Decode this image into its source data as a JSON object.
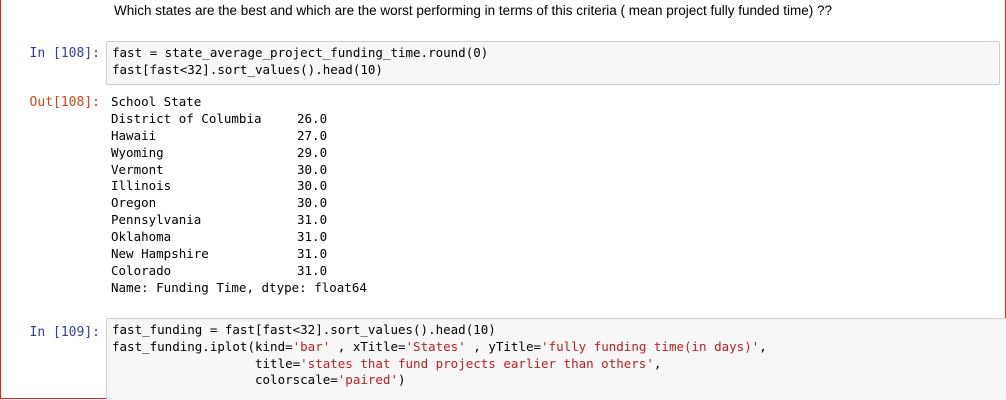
{
  "markdown_text": "Which states are the best and which are the worst performing in terms of this criteria ( mean project fully funded time) ??",
  "cell1": {
    "prompt": "In [108]:",
    "lines": [
      "fast = state_average_project_funding_time.round(0)",
      "fast[fast<32].sort_values().head(10)"
    ]
  },
  "output1": {
    "prompt": "Out[108]:",
    "index_name": "School State",
    "rows": [
      {
        "state": "District of Columbia",
        "value": "26.0"
      },
      {
        "state": "Hawaii",
        "value": "27.0"
      },
      {
        "state": "Wyoming",
        "value": "29.0"
      },
      {
        "state": "Vermont",
        "value": "30.0"
      },
      {
        "state": "Illinois",
        "value": "30.0"
      },
      {
        "state": "Oregon",
        "value": "30.0"
      },
      {
        "state": "Pennsylvania",
        "value": "31.0"
      },
      {
        "state": "Oklahoma",
        "value": "31.0"
      },
      {
        "state": "New Hampshire",
        "value": "31.0"
      },
      {
        "state": "Colorado",
        "value": "31.0"
      }
    ],
    "footer": "Name: Funding Time, dtype: float64"
  },
  "cell2": {
    "prompt": "In [109]:",
    "line1": "fast_funding = fast[fast<32].sort_values().head(10)",
    "line2_pre": "fast_funding.iplot(kind=",
    "line2_s1": "'bar'",
    "line2_mid1": " , xTitle=",
    "line2_s2": "'States'",
    "line2_mid2": " , yTitle=",
    "line2_s3": "'fully funding time(in days)'",
    "line2_post": ",",
    "line3_pre": "                   title=",
    "line3_s": "'states that fund projects earlier than others'",
    "line3_post": ",",
    "line4_pre": "                   colorscale=",
    "line4_s": "'paired'",
    "line4_post": ")"
  },
  "colors": {
    "in_prompt": "#303f9f",
    "out_prompt": "#d84315",
    "string": "#ba2121",
    "frame": "#e2231a"
  }
}
